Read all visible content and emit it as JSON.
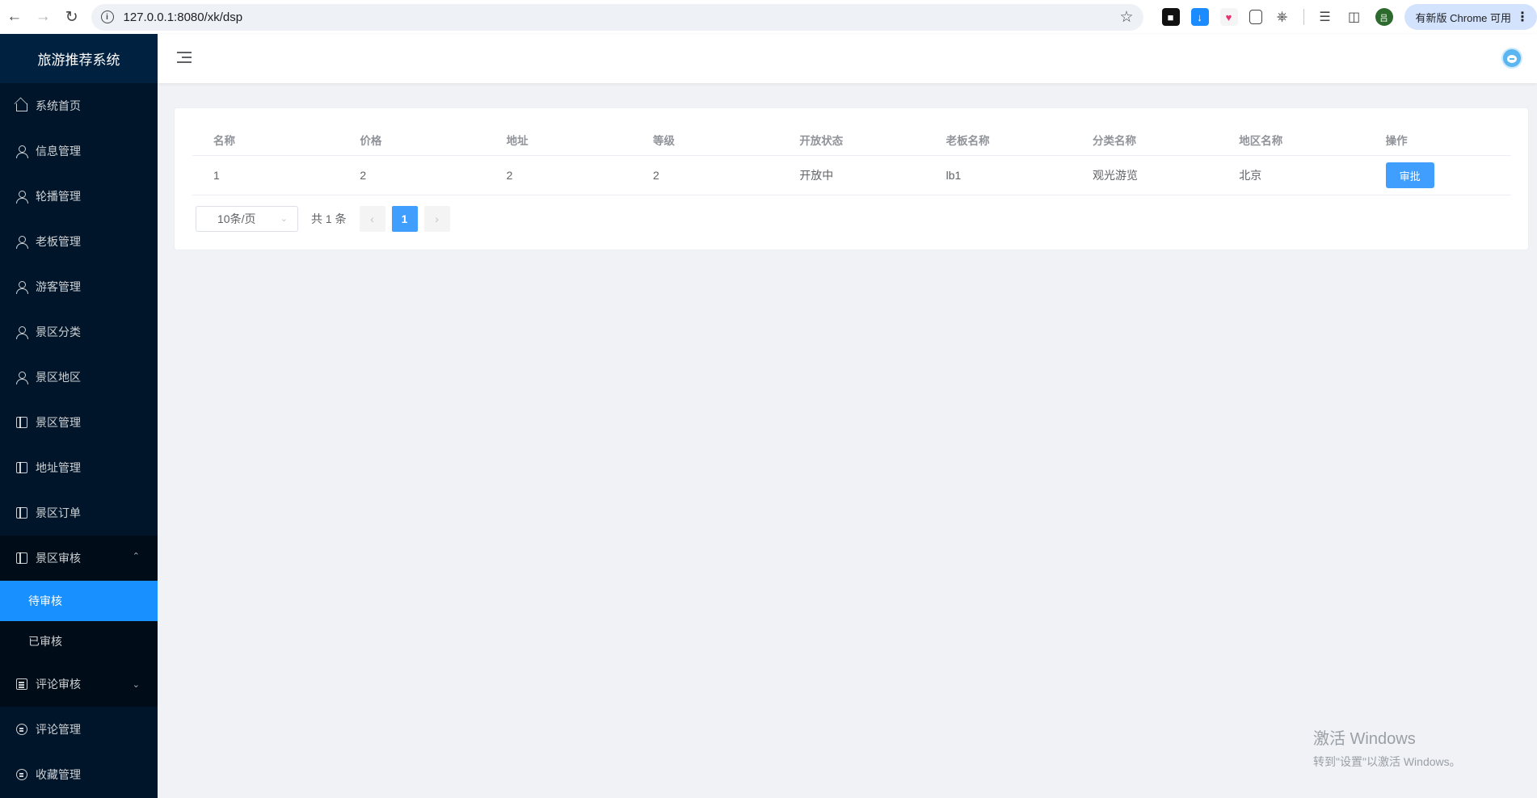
{
  "browser": {
    "url": "127.0.0.1:8080/xk/dsp",
    "update_label": "有新版 Chrome 可用",
    "profile_initial": "吕"
  },
  "sidebar": {
    "title": "旅游推荐系统",
    "items": [
      {
        "label": "系统首页"
      },
      {
        "label": "信息管理"
      },
      {
        "label": "轮播管理"
      },
      {
        "label": "老板管理"
      },
      {
        "label": "游客管理"
      },
      {
        "label": "景区分类"
      },
      {
        "label": "景区地区"
      },
      {
        "label": "景区管理"
      },
      {
        "label": "地址管理"
      },
      {
        "label": "景区订单"
      },
      {
        "label": "景区审核"
      },
      {
        "label": "评论审核"
      },
      {
        "label": "评论管理"
      },
      {
        "label": "收藏管理"
      }
    ],
    "audit_submenu": [
      {
        "label": "待审核"
      },
      {
        "label": "已审核"
      }
    ]
  },
  "table": {
    "headers": [
      "名称",
      "价格",
      "地址",
      "等级",
      "开放状态",
      "老板名称",
      "分类名称",
      "地区名称",
      "操作"
    ],
    "rows": [
      {
        "name": "1",
        "price": "2",
        "address": "2",
        "level": "2",
        "status": "开放中",
        "boss": "lb1",
        "category": "观光游览",
        "region": "北京",
        "action": "审批"
      }
    ]
  },
  "pagination": {
    "page_size": "10条/页",
    "total": "共 1 条",
    "current_page": "1",
    "prev": "‹",
    "next": "›"
  },
  "watermark": {
    "title": "激活 Windows",
    "subtitle": "转到\"设置\"以激活 Windows。"
  },
  "colors": {
    "sidebar_bg": "#001529",
    "accent": "#1890ff",
    "button": "#409eff"
  }
}
